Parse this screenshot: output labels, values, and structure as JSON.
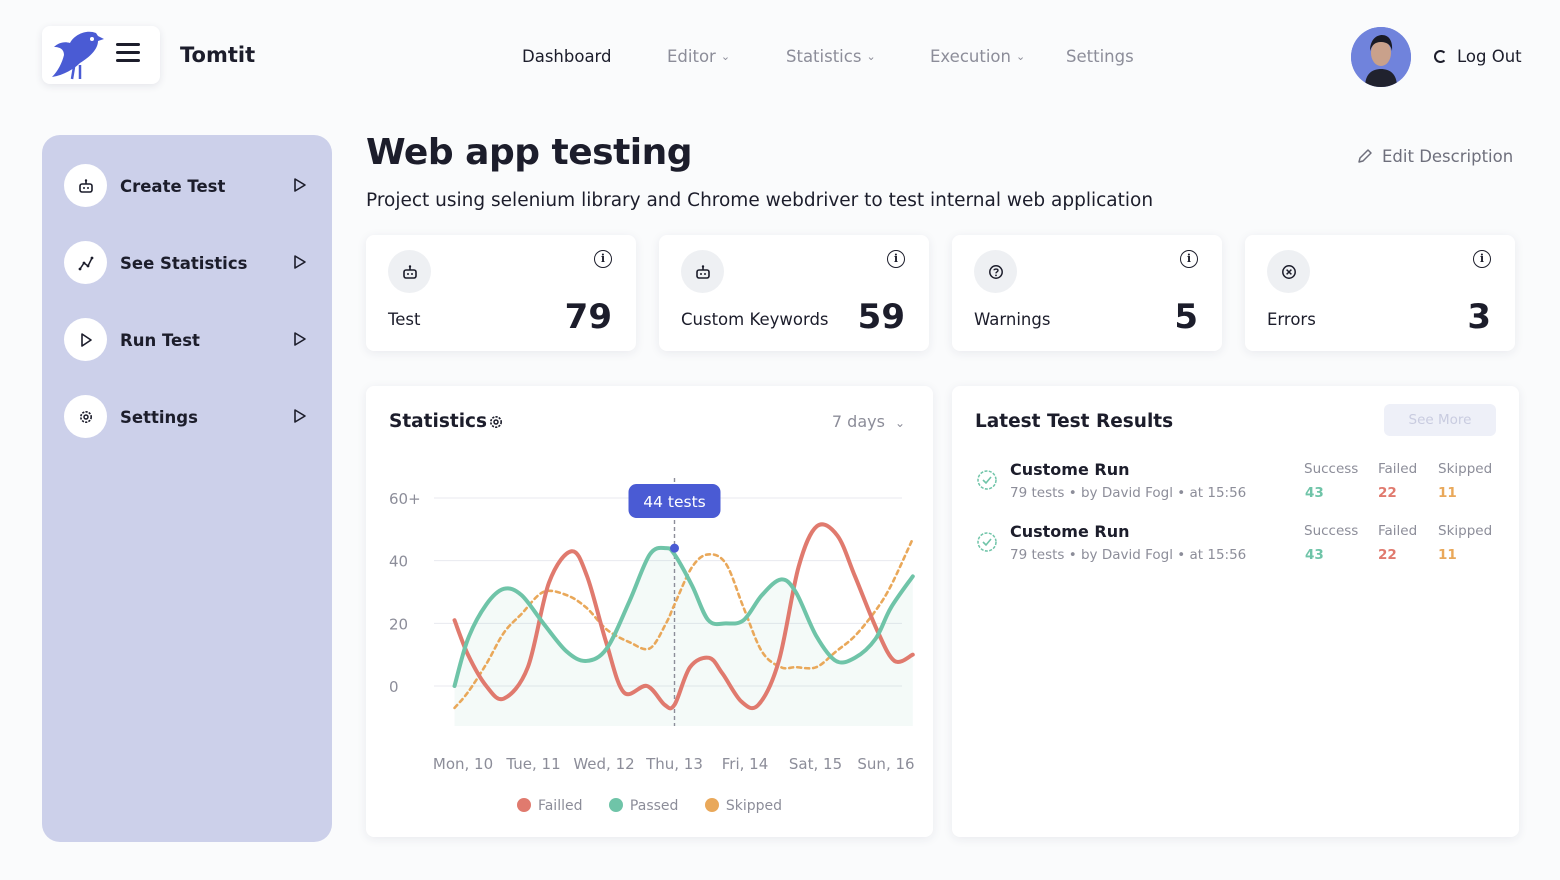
{
  "app": {
    "name": "Tomtit"
  },
  "nav": {
    "items": [
      {
        "label": "Dashboard",
        "active": true,
        "dropdown": false
      },
      {
        "label": "Editor",
        "active": false,
        "dropdown": true
      },
      {
        "label": "Statistics",
        "active": false,
        "dropdown": true
      },
      {
        "label": "Execution",
        "active": false,
        "dropdown": true
      },
      {
        "label": "Settings",
        "active": false,
        "dropdown": false
      }
    ],
    "logout": "Log Out"
  },
  "sidebar": {
    "items": [
      {
        "label": "Create Test",
        "icon": "robot-icon"
      },
      {
        "label": "See Statistics",
        "icon": "chart-line-icon"
      },
      {
        "label": "Run Test",
        "icon": "play-icon"
      },
      {
        "label": "Settings",
        "icon": "gear-icon"
      }
    ]
  },
  "header": {
    "title": "Web app testing",
    "description": "Project using selenium library and Chrome webdriver to test internal web application",
    "edit_label": "Edit Description"
  },
  "stats_cards": [
    {
      "label": "Test",
      "value": "79",
      "icon": "robot-icon"
    },
    {
      "label": "Custom Keywords",
      "value": "59",
      "icon": "robot-icon"
    },
    {
      "label": "Warnings",
      "value": "5",
      "icon": "question-icon"
    },
    {
      "label": "Errors",
      "value": "3",
      "icon": "x-circle-icon"
    }
  ],
  "statistics": {
    "title": "Statistics",
    "range": "7 days",
    "tooltip": "44 tests",
    "legend": [
      "Failled",
      "Passed",
      "Skipped"
    ]
  },
  "chart_data": {
    "type": "line",
    "categories": [
      "Mon, 10",
      "Tue, 11",
      "Wed, 12",
      "Thu, 13",
      "Fri, 14",
      "Sat, 15",
      "Sun, 16"
    ],
    "y_tick_labels": [
      "0",
      "20",
      "40",
      "60+"
    ],
    "y_ticks": [
      0,
      20,
      40,
      60
    ],
    "ylim": [
      -6,
      66
    ],
    "series": [
      {
        "name": "Failled",
        "color": "#e07a6e",
        "style": "solid",
        "x": [
          -0.12,
          0.07,
          0.33,
          0.58,
          0.92,
          1.22,
          1.54,
          1.76,
          2.03,
          2.28,
          2.61,
          2.86,
          3.0,
          3.22,
          3.49,
          3.68,
          3.95,
          4.19,
          4.48,
          4.76,
          5.02,
          5.31,
          5.56,
          5.87,
          6.12,
          6.38
        ],
        "values": [
          21,
          10,
          0,
          -4,
          6,
          33,
          43,
          35,
          14,
          -2,
          0,
          -6,
          -6,
          6,
          9,
          4,
          -5,
          -6,
          8,
          38,
          51,
          48,
          35,
          18,
          8,
          10
        ]
      },
      {
        "name": "Passed",
        "color": "#6fc4a8",
        "style": "solid",
        "x": [
          -0.12,
          0.07,
          0.33,
          0.58,
          0.83,
          1.14,
          1.47,
          1.75,
          2.04,
          2.36,
          2.65,
          2.88,
          3.0,
          3.25,
          3.48,
          3.73,
          3.98,
          4.24,
          4.51,
          4.72,
          5.01,
          5.29,
          5.56,
          5.85,
          6.07,
          6.38
        ],
        "values": [
          0,
          15,
          26,
          31,
          29,
          20,
          11,
          8,
          12,
          27,
          42,
          44,
          42,
          32,
          21,
          20,
          21,
          29,
          34,
          30,
          16,
          8,
          9,
          15,
          25,
          35
        ]
      },
      {
        "name": "Skipped",
        "color": "#e9a85a",
        "style": "dashed",
        "x": [
          -0.12,
          0.07,
          0.33,
          0.58,
          0.83,
          1.14,
          1.47,
          1.75,
          2.04,
          2.36,
          2.65,
          2.88,
          3.0,
          3.25,
          3.48,
          3.73,
          3.98,
          4.24,
          4.51,
          4.72,
          5.01,
          5.29,
          5.56,
          5.85,
          6.07,
          6.38
        ],
        "values": [
          -7,
          -2,
          7,
          17,
          23,
          30,
          29,
          25,
          18,
          14,
          12,
          20,
          26,
          38,
          42,
          39,
          25,
          11,
          6,
          6,
          6,
          11,
          16,
          24,
          32,
          47
        ]
      }
    ],
    "highlight": {
      "x": 3.0,
      "value": 44
    },
    "area_under": "Passed",
    "grid": true,
    "legend_position": "bottom"
  },
  "results": {
    "title": "Latest Test Results",
    "see_more": "See More",
    "columns": [
      "Success",
      "Failed",
      "Skipped"
    ],
    "column_colors": [
      "#6fc4a8",
      "#e07a6e",
      "#e9a85a"
    ],
    "runs": [
      {
        "name": "Custome Run",
        "meta": "79 tests • by David Fogl • at 15:56",
        "success": "43",
        "failed": "22",
        "skipped": "11"
      },
      {
        "name": "Custome Run",
        "meta": "79 tests • by David Fogl • at 15:56",
        "success": "43",
        "failed": "22",
        "skipped": "11"
      }
    ]
  }
}
